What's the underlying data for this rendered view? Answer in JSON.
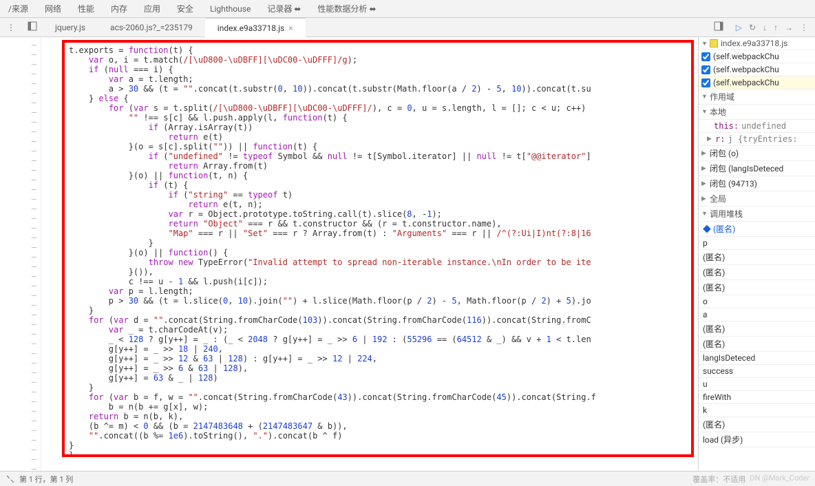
{
  "topTabs": [
    "/来源",
    "网络",
    "性能",
    "内存",
    "应用",
    "安全",
    "Lighthouse",
    "记录器 ⬌",
    "性能数据分析 ⬌"
  ],
  "fileTabs": [
    {
      "label": "jquery.js",
      "active": false
    },
    {
      "label": "acs-2060.js?_=235179",
      "active": false
    },
    {
      "label": "index.e9a33718.js",
      "active": true
    }
  ],
  "sidebar": {
    "fileTitle": "index.e9a33718.js",
    "webpack": [
      "(self.webpackChu",
      "(self.webpackChu",
      "(self.webpackChu"
    ],
    "sections": {
      "scope": "作用域",
      "local": "本地",
      "global": "全局",
      "callstack": "调用堆栈"
    },
    "local": {
      "thisKey": "this:",
      "thisVal": "undefined",
      "rKey": "r:",
      "rVal": "j {tryEntries:"
    },
    "closures": [
      "闭包 (o)",
      "闭包 (langIsDeteced",
      "闭包 (94713)"
    ],
    "callstack": [
      "(匿名)",
      "p",
      "(匿名)",
      "(匿名)",
      "(匿名)",
      "o",
      "a",
      "(匿名)",
      "(匿名)",
      "langIsDeteced",
      "success",
      "u",
      "fireWith",
      "k",
      "(匿名)",
      "load (异步)"
    ]
  },
  "statusbar": {
    "pos": "第 1 行，第 1 列",
    "coverage": "覆盖率：不适用",
    "watermark": "DN @Mark_Coder"
  },
  "code": "t.exports = <span class='tok-kw'>function</span>(t) {\n    <span class='tok-kw'>var</span> o, i = t.match(<span class='tok-regex'>/[\\uD800-\\uDBFF][\\uDC00-\\uDFFF]/g</span>);\n    <span class='tok-kw'>if</span> (<span class='tok-kw'>null</span> === i) {\n        <span class='tok-kw'>var</span> a = t.length;\n        a > <span class='tok-num'>30</span> && (t = <span class='tok-str'>\"\"</span>.concat(t.substr(<span class='tok-num'>0</span>, <span class='tok-num'>10</span>)).concat(t.substr(Math.floor(a / <span class='tok-num'>2</span>) - <span class='tok-num'>5</span>, <span class='tok-num'>10</span>)).concat(t.su\n    } <span class='tok-kw'>else</span> {\n        <span class='tok-kw'>for</span> (<span class='tok-kw'>var</span> s = t.split(<span class='tok-regex'>/[\\uD800-\\uDBFF][\\uDC00-\\uDFFF]/</span>), c = <span class='tok-num'>0</span>, u = s.length, l = []; c < u; c++)\n            <span class='tok-str'>\"\"</span> !== s[c] && l.push.apply(l, <span class='tok-kw'>function</span>(t) {\n                <span class='tok-kw'>if</span> (Array.isArray(t))\n                    <span class='tok-kw'>return</span> e(t)\n            }(o = s[c].split(<span class='tok-str'>\"\"</span>)) || <span class='tok-kw'>function</span>(t) {\n                <span class='tok-kw'>if</span> (<span class='tok-str'>\"undefined\"</span> != <span class='tok-kw'>typeof</span> Symbol && <span class='tok-kw'>null</span> != t[Symbol.iterator] || <span class='tok-kw'>null</span> != t[<span class='tok-str'>\"@@iterator\"</span>]\n                    <span class='tok-kw'>return</span> Array.from(t)\n            }(o) || <span class='tok-kw'>function</span>(t, n) {\n                <span class='tok-kw'>if</span> (t) {\n                    <span class='tok-kw'>if</span> (<span class='tok-str'>\"string\"</span> == <span class='tok-kw'>typeof</span> t)\n                        <span class='tok-kw'>return</span> e(t, n);\n                    <span class='tok-kw'>var</span> r = Object.prototype.toString.call(t).slice(<span class='tok-num'>8</span>, -<span class='tok-num'>1</span>);\n                    <span class='tok-kw'>return</span> <span class='tok-str'>\"Object\"</span> === r && t.constructor && (r = t.constructor.name),\n                    <span class='tok-str'>\"Map\"</span> === r || <span class='tok-str'>\"Set\"</span> === r ? Array.from(t) : <span class='tok-str'>\"Arguments\"</span> === r || <span class='tok-regex'>/^(?:Ui|I)nt(?:8|16</span>\n                }\n            }(o) || <span class='tok-kw'>function</span>() {\n                <span class='tok-kw'>throw new</span> TypeError(<span class='tok-str'>\"Invalid attempt to spread non-iterable instance.\\nIn order to be ite</span>\n            }()),\n            c !== u - <span class='tok-num'>1</span> && l.push(i[c]);\n        <span class='tok-kw'>var</span> p = l.length;\n        p > <span class='tok-num'>30</span> && (t = l.slice(<span class='tok-num'>0</span>, <span class='tok-num'>10</span>).join(<span class='tok-str'>\"\"</span>) + l.slice(Math.floor(p / <span class='tok-num'>2</span>) - <span class='tok-num'>5</span>, Math.floor(p / <span class='tok-num'>2</span>) + <span class='tok-num'>5</span>).jo\n    }\n    <span class='tok-kw'>for</span> (<span class='tok-kw'>var</span> d = <span class='tok-str'>\"\"</span>.concat(String.fromCharCode(<span class='tok-num'>103</span>)).concat(String.fromCharCode(<span class='tok-num'>116</span>)).concat(String.fromC\n        <span class='tok-kw'>var</span> _ = t.charCodeAt(v);\n        _ < <span class='tok-num'>128</span> ? g[y++] = _ : (_ < <span class='tok-num'>2048</span> ? g[y++] = _ >> <span class='tok-num'>6</span> | <span class='tok-num'>192</span> : (<span class='tok-num'>55296</span> == (<span class='tok-num'>64512</span> & _) && v + <span class='tok-num'>1</span> < t.len\n        g[y++] = _ >> <span class='tok-num'>18</span> | <span class='tok-num'>240</span>,\n        g[y++] = _ >> <span class='tok-num'>12</span> & <span class='tok-num'>63</span> | <span class='tok-num'>128</span>) : g[y++] = _ >> <span class='tok-num'>12</span> | <span class='tok-num'>224</span>,\n        g[y++] = _ >> <span class='tok-num'>6</span> & <span class='tok-num'>63</span> | <span class='tok-num'>128</span>),\n        g[y++] = <span class='tok-num'>63</span> & _ | <span class='tok-num'>128</span>)\n    }\n    <span class='tok-kw'>for</span> (<span class='tok-kw'>var</span> b = f, w = <span class='tok-str'>\"\"</span>.concat(String.fromCharCode(<span class='tok-num'>43</span>)).concat(String.fromCharCode(<span class='tok-num'>45</span>)).concat(String.f\n        b = n(b += g[x], w);\n    <span class='tok-kw'>return</span> b = n(b, k),\n    (b ^= m) < <span class='tok-num'>0</span> && (b = <span class='tok-num'>2147483648</span> + (<span class='tok-num'>2147483647</span> & b)),\n    <span class='tok-str'>\"\"</span>.concat((b %= <span class='tok-num'>1e6</span>).toString(), <span class='tok-str'>\".\"</span>).concat(b ^ f)\n}\n},"
}
